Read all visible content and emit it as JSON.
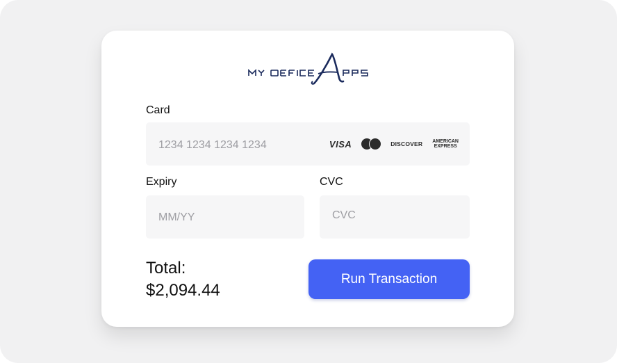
{
  "logo": {
    "text": "MYOFFICEAPPS",
    "color": "#1a2a5c"
  },
  "card_field": {
    "label": "Card",
    "placeholder": "1234 1234 1234 1234",
    "brands": {
      "visa": "VISA",
      "discover": "DISCOVER",
      "amex_line1": "AMERICAN",
      "amex_line2": "EXPRESS"
    }
  },
  "expiry_field": {
    "label": "Expiry",
    "placeholder": "MM/YY"
  },
  "cvc_field": {
    "label": "CVC",
    "placeholder": "CVC"
  },
  "total": {
    "label": "Total:",
    "amount": "$2,094.44"
  },
  "submit": {
    "label": "Run Transaction",
    "color": "#4462f4"
  }
}
